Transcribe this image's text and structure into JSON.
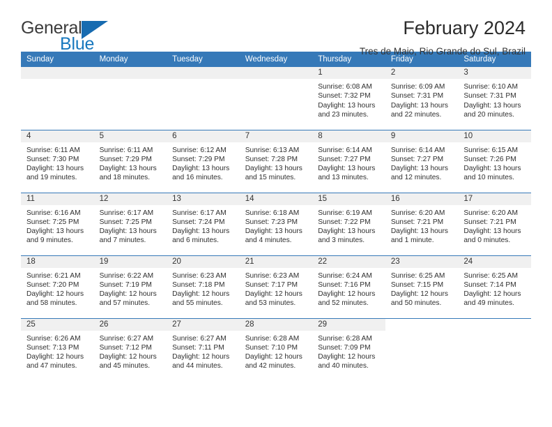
{
  "brand": {
    "name_part1": "General",
    "name_part2": "Blue",
    "logo_icon": "triangle-flag-icon"
  },
  "header": {
    "title": "February 2024",
    "subtitle": "Tres de Maio, Rio Grande do Sul, Brazil"
  },
  "colors": {
    "header_blue": "#3679b8",
    "brand_blue": "#1878be",
    "daynum_band": "#f0f0f0",
    "text": "#2e2e2e"
  },
  "weekday_headers": [
    "Sunday",
    "Monday",
    "Tuesday",
    "Wednesday",
    "Thursday",
    "Friday",
    "Saturday"
  ],
  "weeks": [
    [
      {
        "day": "",
        "sunrise": "",
        "sunset": "",
        "daylight_line1": "",
        "daylight_line2": "",
        "empty": true
      },
      {
        "day": "",
        "sunrise": "",
        "sunset": "",
        "daylight_line1": "",
        "daylight_line2": "",
        "empty": true
      },
      {
        "day": "",
        "sunrise": "",
        "sunset": "",
        "daylight_line1": "",
        "daylight_line2": "",
        "empty": true
      },
      {
        "day": "",
        "sunrise": "",
        "sunset": "",
        "daylight_line1": "",
        "daylight_line2": "",
        "empty": true
      },
      {
        "day": "1",
        "sunrise": "Sunrise: 6:08 AM",
        "sunset": "Sunset: 7:32 PM",
        "daylight_line1": "Daylight: 13 hours",
        "daylight_line2": "and 23 minutes."
      },
      {
        "day": "2",
        "sunrise": "Sunrise: 6:09 AM",
        "sunset": "Sunset: 7:31 PM",
        "daylight_line1": "Daylight: 13 hours",
        "daylight_line2": "and 22 minutes."
      },
      {
        "day": "3",
        "sunrise": "Sunrise: 6:10 AM",
        "sunset": "Sunset: 7:31 PM",
        "daylight_line1": "Daylight: 13 hours",
        "daylight_line2": "and 20 minutes."
      }
    ],
    [
      {
        "day": "4",
        "sunrise": "Sunrise: 6:11 AM",
        "sunset": "Sunset: 7:30 PM",
        "daylight_line1": "Daylight: 13 hours",
        "daylight_line2": "and 19 minutes."
      },
      {
        "day": "5",
        "sunrise": "Sunrise: 6:11 AM",
        "sunset": "Sunset: 7:29 PM",
        "daylight_line1": "Daylight: 13 hours",
        "daylight_line2": "and 18 minutes."
      },
      {
        "day": "6",
        "sunrise": "Sunrise: 6:12 AM",
        "sunset": "Sunset: 7:29 PM",
        "daylight_line1": "Daylight: 13 hours",
        "daylight_line2": "and 16 minutes."
      },
      {
        "day": "7",
        "sunrise": "Sunrise: 6:13 AM",
        "sunset": "Sunset: 7:28 PM",
        "daylight_line1": "Daylight: 13 hours",
        "daylight_line2": "and 15 minutes."
      },
      {
        "day": "8",
        "sunrise": "Sunrise: 6:14 AM",
        "sunset": "Sunset: 7:27 PM",
        "daylight_line1": "Daylight: 13 hours",
        "daylight_line2": "and 13 minutes."
      },
      {
        "day": "9",
        "sunrise": "Sunrise: 6:14 AM",
        "sunset": "Sunset: 7:27 PM",
        "daylight_line1": "Daylight: 13 hours",
        "daylight_line2": "and 12 minutes."
      },
      {
        "day": "10",
        "sunrise": "Sunrise: 6:15 AM",
        "sunset": "Sunset: 7:26 PM",
        "daylight_line1": "Daylight: 13 hours",
        "daylight_line2": "and 10 minutes."
      }
    ],
    [
      {
        "day": "11",
        "sunrise": "Sunrise: 6:16 AM",
        "sunset": "Sunset: 7:25 PM",
        "daylight_line1": "Daylight: 13 hours",
        "daylight_line2": "and 9 minutes."
      },
      {
        "day": "12",
        "sunrise": "Sunrise: 6:17 AM",
        "sunset": "Sunset: 7:25 PM",
        "daylight_line1": "Daylight: 13 hours",
        "daylight_line2": "and 7 minutes."
      },
      {
        "day": "13",
        "sunrise": "Sunrise: 6:17 AM",
        "sunset": "Sunset: 7:24 PM",
        "daylight_line1": "Daylight: 13 hours",
        "daylight_line2": "and 6 minutes."
      },
      {
        "day": "14",
        "sunrise": "Sunrise: 6:18 AM",
        "sunset": "Sunset: 7:23 PM",
        "daylight_line1": "Daylight: 13 hours",
        "daylight_line2": "and 4 minutes."
      },
      {
        "day": "15",
        "sunrise": "Sunrise: 6:19 AM",
        "sunset": "Sunset: 7:22 PM",
        "daylight_line1": "Daylight: 13 hours",
        "daylight_line2": "and 3 minutes."
      },
      {
        "day": "16",
        "sunrise": "Sunrise: 6:20 AM",
        "sunset": "Sunset: 7:21 PM",
        "daylight_line1": "Daylight: 13 hours",
        "daylight_line2": "and 1 minute."
      },
      {
        "day": "17",
        "sunrise": "Sunrise: 6:20 AM",
        "sunset": "Sunset: 7:21 PM",
        "daylight_line1": "Daylight: 13 hours",
        "daylight_line2": "and 0 minutes."
      }
    ],
    [
      {
        "day": "18",
        "sunrise": "Sunrise: 6:21 AM",
        "sunset": "Sunset: 7:20 PM",
        "daylight_line1": "Daylight: 12 hours",
        "daylight_line2": "and 58 minutes."
      },
      {
        "day": "19",
        "sunrise": "Sunrise: 6:22 AM",
        "sunset": "Sunset: 7:19 PM",
        "daylight_line1": "Daylight: 12 hours",
        "daylight_line2": "and 57 minutes."
      },
      {
        "day": "20",
        "sunrise": "Sunrise: 6:23 AM",
        "sunset": "Sunset: 7:18 PM",
        "daylight_line1": "Daylight: 12 hours",
        "daylight_line2": "and 55 minutes."
      },
      {
        "day": "21",
        "sunrise": "Sunrise: 6:23 AM",
        "sunset": "Sunset: 7:17 PM",
        "daylight_line1": "Daylight: 12 hours",
        "daylight_line2": "and 53 minutes."
      },
      {
        "day": "22",
        "sunrise": "Sunrise: 6:24 AM",
        "sunset": "Sunset: 7:16 PM",
        "daylight_line1": "Daylight: 12 hours",
        "daylight_line2": "and 52 minutes."
      },
      {
        "day": "23",
        "sunrise": "Sunrise: 6:25 AM",
        "sunset": "Sunset: 7:15 PM",
        "daylight_line1": "Daylight: 12 hours",
        "daylight_line2": "and 50 minutes."
      },
      {
        "day": "24",
        "sunrise": "Sunrise: 6:25 AM",
        "sunset": "Sunset: 7:14 PM",
        "daylight_line1": "Daylight: 12 hours",
        "daylight_line2": "and 49 minutes."
      }
    ],
    [
      {
        "day": "25",
        "sunrise": "Sunrise: 6:26 AM",
        "sunset": "Sunset: 7:13 PM",
        "daylight_line1": "Daylight: 12 hours",
        "daylight_line2": "and 47 minutes."
      },
      {
        "day": "26",
        "sunrise": "Sunrise: 6:27 AM",
        "sunset": "Sunset: 7:12 PM",
        "daylight_line1": "Daylight: 12 hours",
        "daylight_line2": "and 45 minutes."
      },
      {
        "day": "27",
        "sunrise": "Sunrise: 6:27 AM",
        "sunset": "Sunset: 7:11 PM",
        "daylight_line1": "Daylight: 12 hours",
        "daylight_line2": "and 44 minutes."
      },
      {
        "day": "28",
        "sunrise": "Sunrise: 6:28 AM",
        "sunset": "Sunset: 7:10 PM",
        "daylight_line1": "Daylight: 12 hours",
        "daylight_line2": "and 42 minutes."
      },
      {
        "day": "29",
        "sunrise": "Sunrise: 6:28 AM",
        "sunset": "Sunset: 7:09 PM",
        "daylight_line1": "Daylight: 12 hours",
        "daylight_line2": "and 40 minutes."
      },
      {
        "day": "",
        "sunrise": "",
        "sunset": "",
        "daylight_line1": "",
        "daylight_line2": "",
        "blank": true
      },
      {
        "day": "",
        "sunrise": "",
        "sunset": "",
        "daylight_line1": "",
        "daylight_line2": "",
        "blank": true
      }
    ]
  ]
}
